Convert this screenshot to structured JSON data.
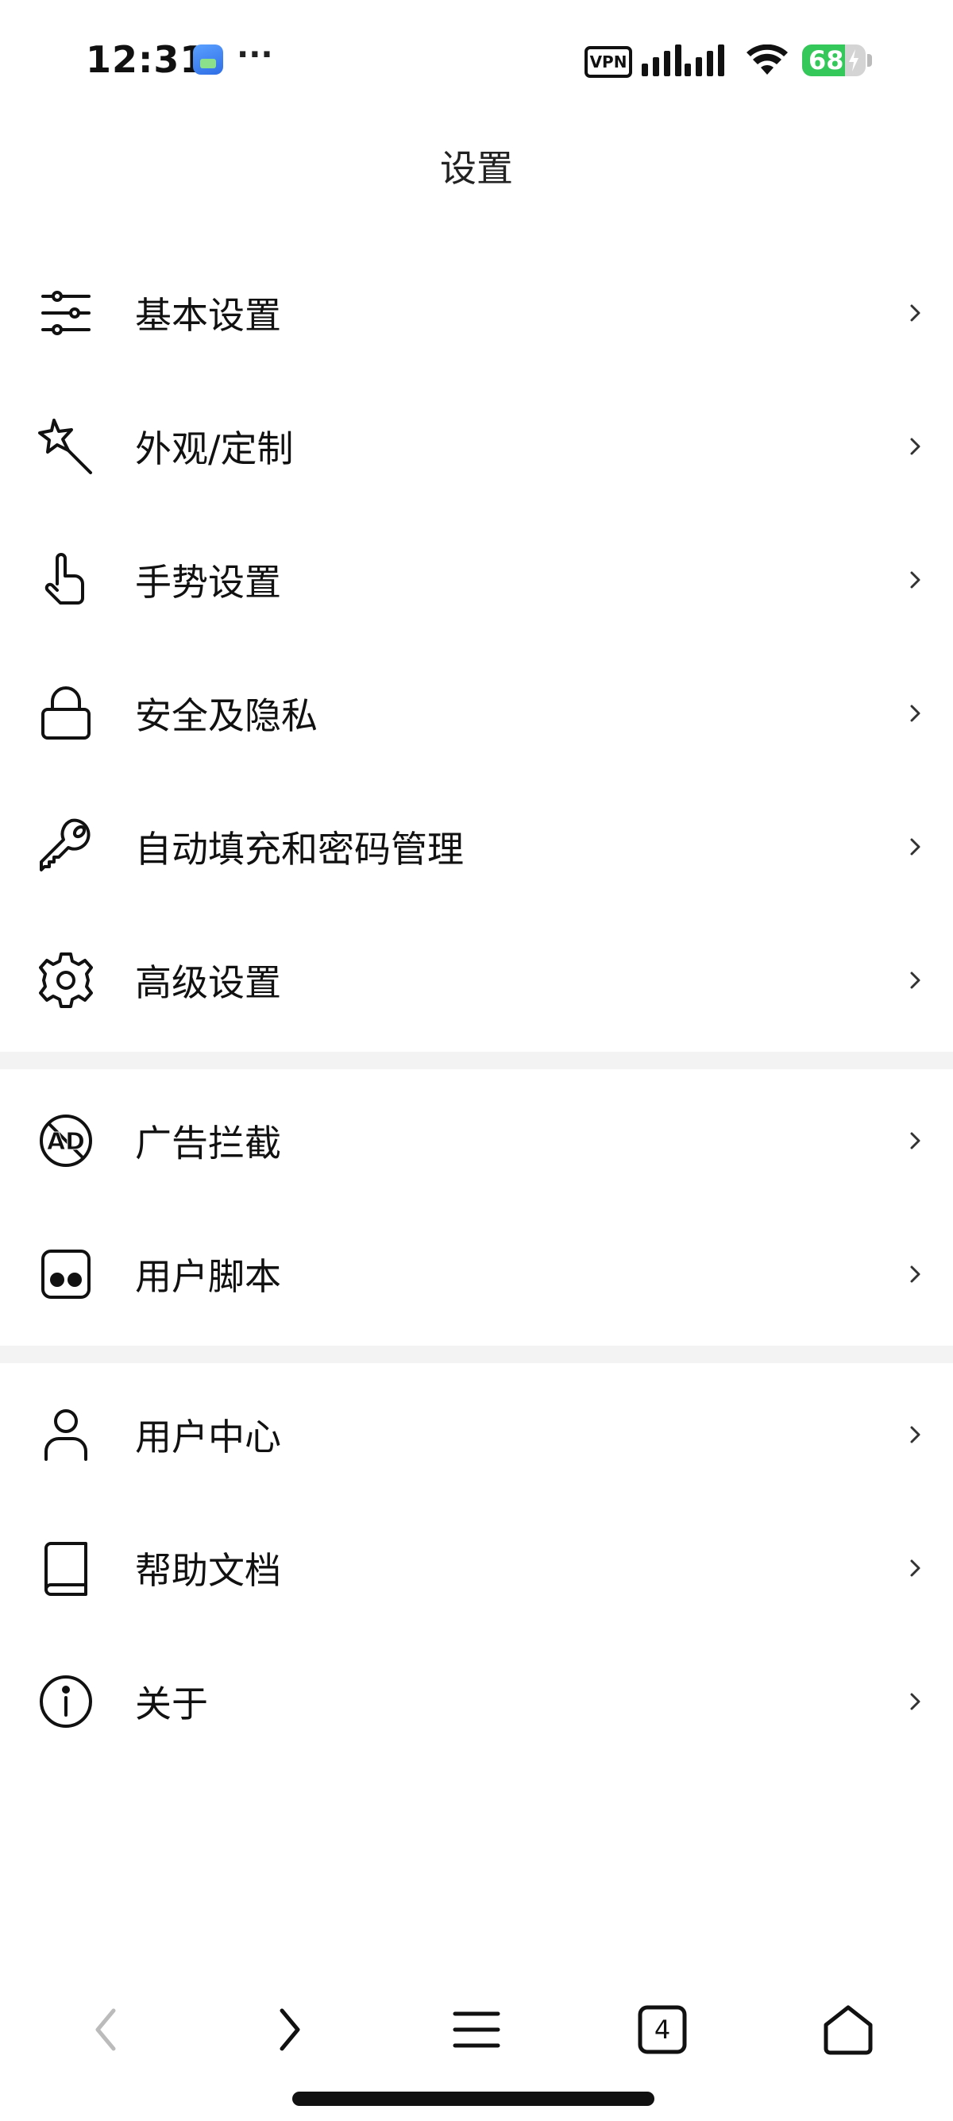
{
  "status_bar": {
    "time": "12:31",
    "more": "···",
    "vpn": "VPN",
    "battery_percent": "68",
    "battery_level": 0.68
  },
  "header": {
    "title": "设置"
  },
  "sections": [
    {
      "items": [
        {
          "label": "基本设置",
          "icon": "sliders-icon"
        },
        {
          "label": "外观/定制",
          "icon": "magic-wand-icon"
        },
        {
          "label": "手势设置",
          "icon": "hand-pointer-icon"
        },
        {
          "label": "安全及隐私",
          "icon": "lock-icon"
        },
        {
          "label": "自动填充和密码管理",
          "icon": "key-icon"
        },
        {
          "label": "高级设置",
          "icon": "gear-icon"
        }
      ]
    },
    {
      "items": [
        {
          "label": "广告拦截",
          "icon": "ad-block-icon"
        },
        {
          "label": "用户脚本",
          "icon": "script-icon"
        }
      ]
    },
    {
      "items": [
        {
          "label": "用户中心",
          "icon": "user-icon"
        },
        {
          "label": "帮助文档",
          "icon": "book-icon"
        },
        {
          "label": "关于",
          "icon": "info-icon"
        }
      ]
    }
  ],
  "chevron": "›",
  "bottom_nav": {
    "tab_count": "4"
  },
  "colors": {
    "divider": "#f3f3f3",
    "battery_green": "#34c759",
    "text": "#111111"
  }
}
